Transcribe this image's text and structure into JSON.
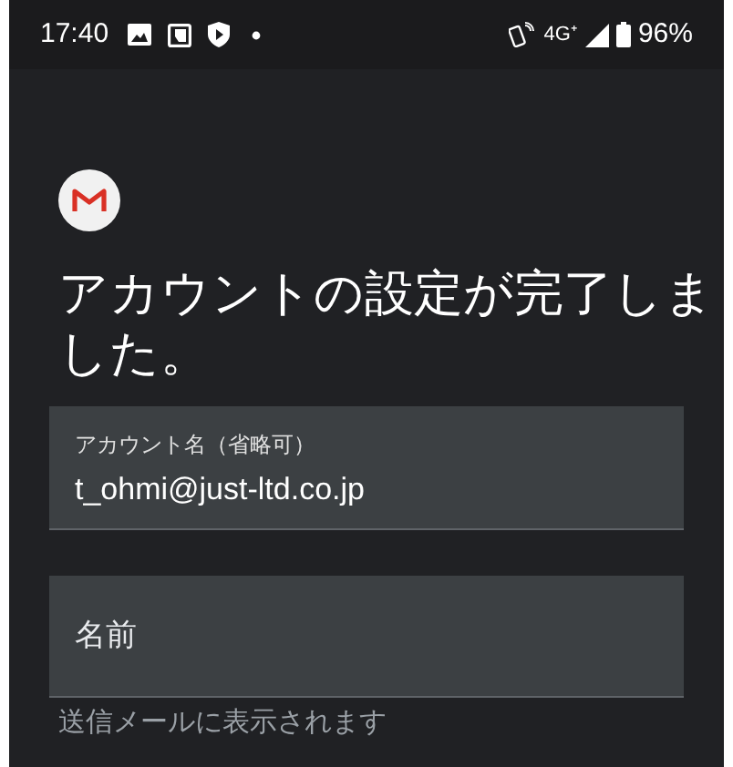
{
  "status_bar": {
    "time": "17:40",
    "network": "4G⁺",
    "battery": "96%"
  },
  "title": "アカウントの設定が完了しました。",
  "account_field": {
    "label": "アカウント名（省略可）",
    "value": "t_ohmi@just-ltd.co.jp"
  },
  "name_field": {
    "placeholder": "名前",
    "helper": "送信メールに表示されます"
  }
}
